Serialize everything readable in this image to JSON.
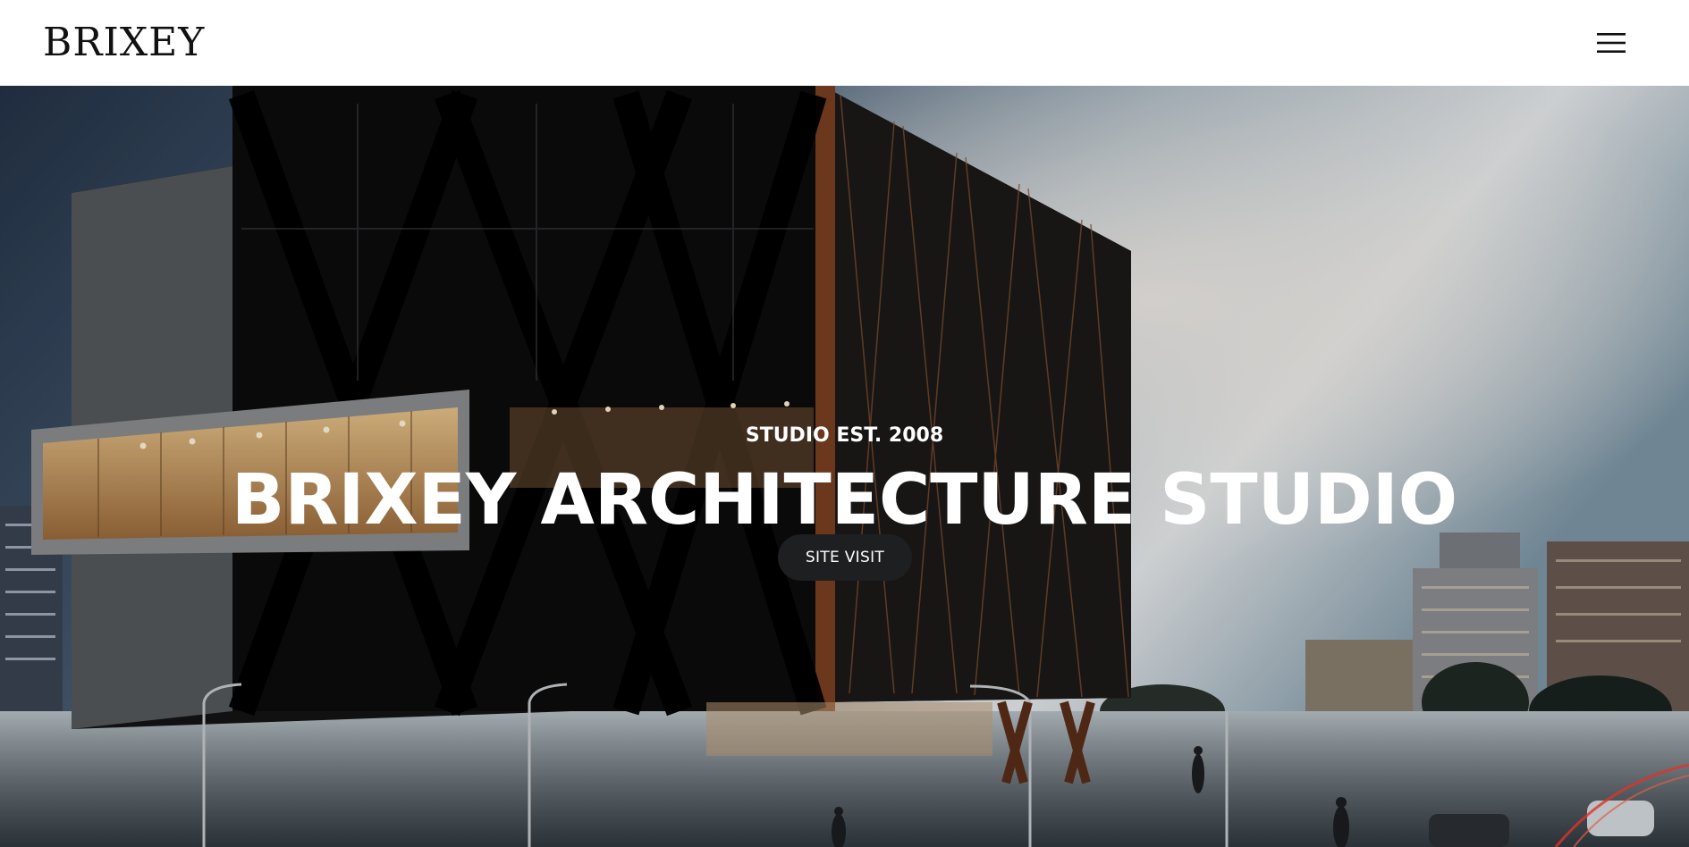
{
  "header": {
    "logo": "BRIXEY",
    "menu_icon": "hamburger-menu-icon"
  },
  "hero": {
    "eyebrow": "STUDIO EST. 2008",
    "title": "BRIXEY ARCHITECTURE STUDIO",
    "cta_label": "SITE VISIT",
    "background_image": "architecture-building-at-dusk"
  },
  "colors": {
    "header_bg": "#ffffff",
    "logo": "#111111",
    "hero_text": "#ffffff",
    "cta_bg": "#1e1f21"
  }
}
